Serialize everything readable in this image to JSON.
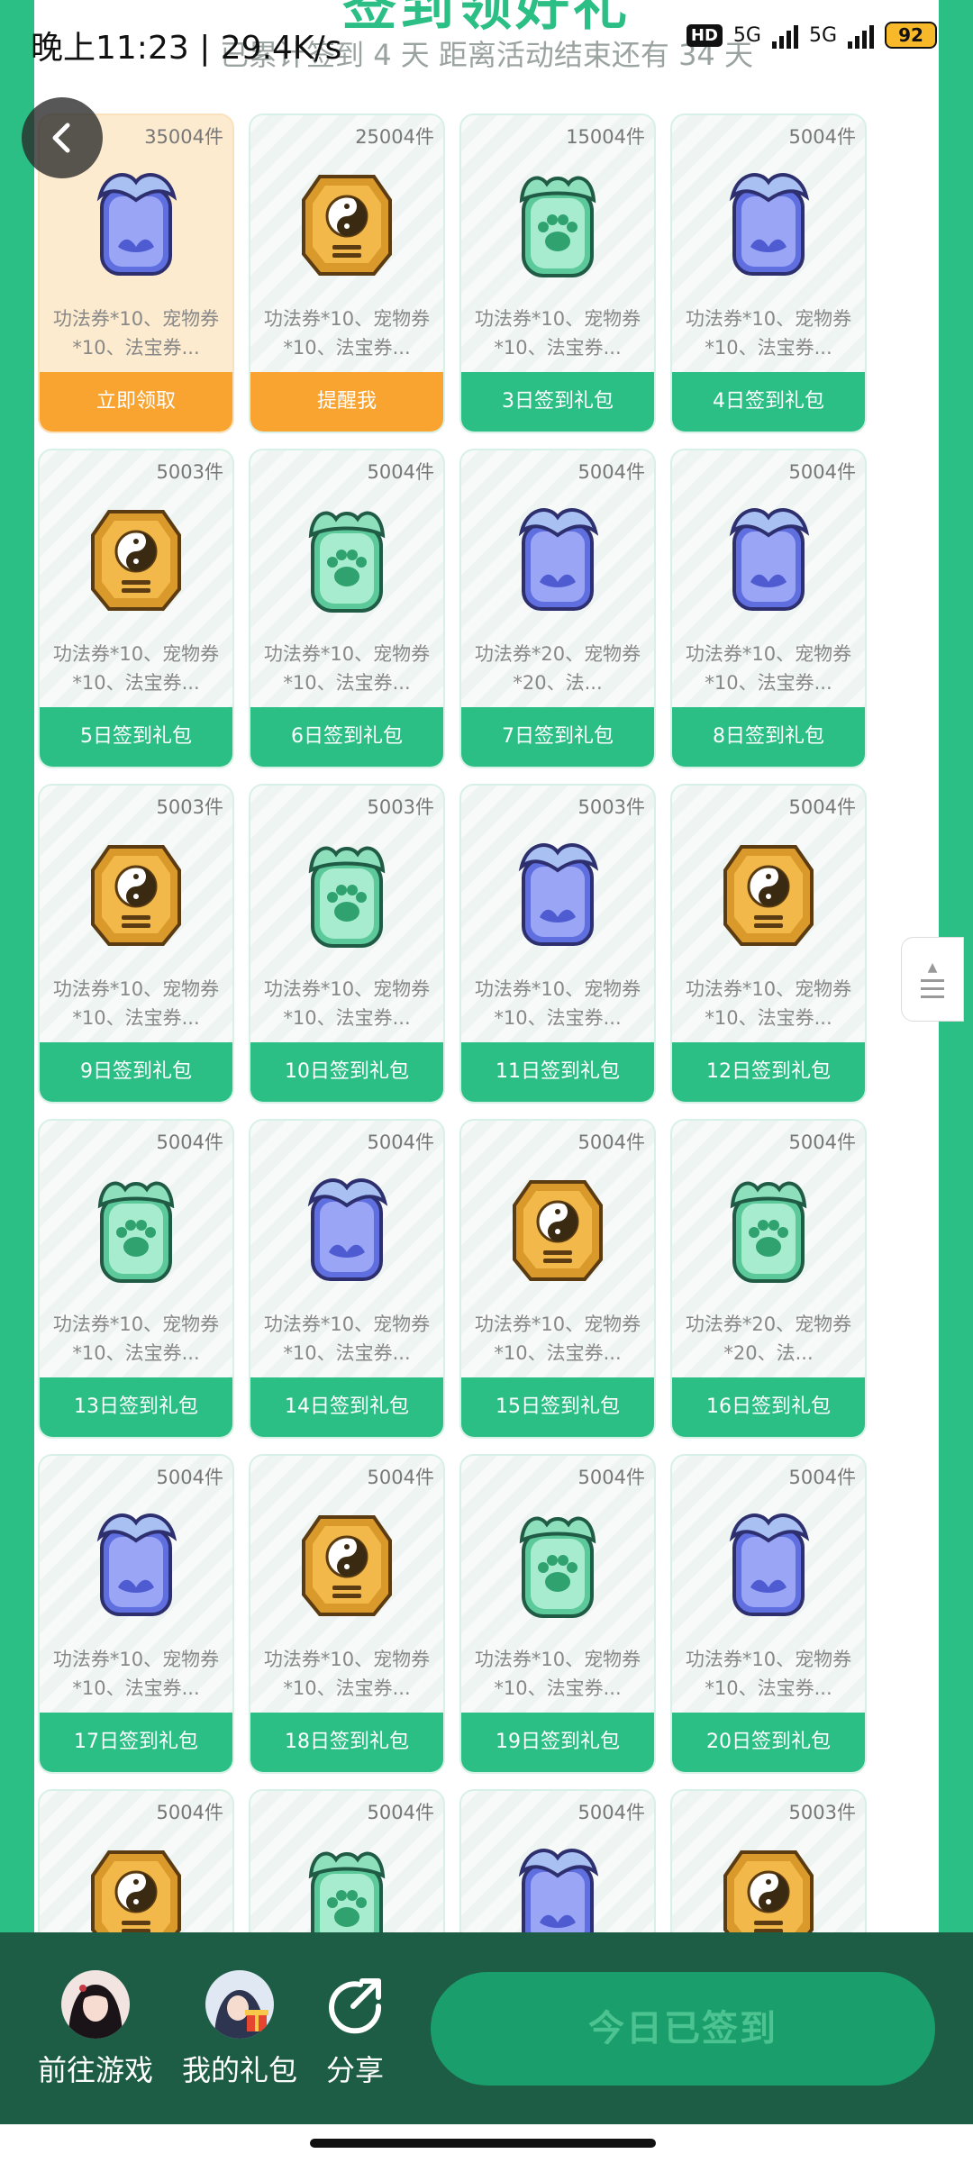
{
  "status_bar": {
    "time": "晚上11:23 | 29.4K/s",
    "network1": "5G",
    "network2": "5G",
    "hd": "HD",
    "battery": "92"
  },
  "banner": {
    "title": "签到领好礼",
    "subtitle": "已累计签到 4 天  距离活动结束还有 34 天"
  },
  "colors": {
    "accent": "#2bbf86",
    "orange": "#f9a431",
    "bottom_bar": "#1d5c45"
  },
  "rewards": [
    {
      "count": "35004件",
      "desc": "功法券*10、宠物券*10、法宝券...",
      "button": "立即领取",
      "icon": "blue-ghost-icon",
      "state": "claim"
    },
    {
      "count": "25004件",
      "desc": "功法券*10、宠物券*10、法宝券...",
      "button": "提醒我",
      "icon": "gold-taiji-icon",
      "state": "remind"
    },
    {
      "count": "15004件",
      "desc": "功法券*10、宠物券*10、法宝券...",
      "button": "3日签到礼包",
      "icon": "green-paw-icon",
      "state": "normal"
    },
    {
      "count": "5004件",
      "desc": "功法券*10、宠物券*10、法宝券...",
      "button": "4日签到礼包",
      "icon": "blue-ghost-icon",
      "state": "normal"
    },
    {
      "count": "5003件",
      "desc": "功法券*10、宠物券*10、法宝券...",
      "button": "5日签到礼包",
      "icon": "gold-taiji-icon",
      "state": "normal"
    },
    {
      "count": "5004件",
      "desc": "功法券*10、宠物券*10、法宝券...",
      "button": "6日签到礼包",
      "icon": "green-paw-icon",
      "state": "normal"
    },
    {
      "count": "5004件",
      "desc": "功法券*20、宠物券*20、法...",
      "button": "7日签到礼包",
      "icon": "blue-ghost-icon",
      "state": "normal"
    },
    {
      "count": "5004件",
      "desc": "功法券*10、宠物券*10、法宝券...",
      "button": "8日签到礼包",
      "icon": "blue-ghost-icon",
      "state": "normal"
    },
    {
      "count": "5003件",
      "desc": "功法券*10、宠物券*10、法宝券...",
      "button": "9日签到礼包",
      "icon": "gold-taiji-icon",
      "state": "normal"
    },
    {
      "count": "5003件",
      "desc": "功法券*10、宠物券*10、法宝券...",
      "button": "10日签到礼包",
      "icon": "green-paw-icon",
      "state": "normal"
    },
    {
      "count": "5003件",
      "desc": "功法券*10、宠物券*10、法宝券...",
      "button": "11日签到礼包",
      "icon": "blue-ghost-icon",
      "state": "normal"
    },
    {
      "count": "5004件",
      "desc": "功法券*10、宠物券*10、法宝券...",
      "button": "12日签到礼包",
      "icon": "gold-taiji-icon",
      "state": "normal"
    },
    {
      "count": "5004件",
      "desc": "功法券*10、宠物券*10、法宝券...",
      "button": "13日签到礼包",
      "icon": "green-paw-icon",
      "state": "normal"
    },
    {
      "count": "5004件",
      "desc": "功法券*10、宠物券*10、法宝券...",
      "button": "14日签到礼包",
      "icon": "blue-ghost-icon",
      "state": "normal"
    },
    {
      "count": "5004件",
      "desc": "功法券*10、宠物券*10、法宝券...",
      "button": "15日签到礼包",
      "icon": "gold-taiji-icon",
      "state": "normal"
    },
    {
      "count": "5004件",
      "desc": "功法券*20、宠物券*20、法...",
      "button": "16日签到礼包",
      "icon": "green-paw-icon",
      "state": "normal"
    },
    {
      "count": "5004件",
      "desc": "功法券*10、宠物券*10、法宝券...",
      "button": "17日签到礼包",
      "icon": "blue-ghost-icon",
      "state": "normal"
    },
    {
      "count": "5004件",
      "desc": "功法券*10、宠物券*10、法宝券...",
      "button": "18日签到礼包",
      "icon": "gold-taiji-icon",
      "state": "normal"
    },
    {
      "count": "5004件",
      "desc": "功法券*10、宠物券*10、法宝券...",
      "button": "19日签到礼包",
      "icon": "green-paw-icon",
      "state": "normal"
    },
    {
      "count": "5004件",
      "desc": "功法券*10、宠物券*10、法宝券...",
      "button": "20日签到礼包",
      "icon": "blue-ghost-icon",
      "state": "normal"
    },
    {
      "count": "5004件",
      "desc": "",
      "button": "",
      "icon": "gold-taiji-icon",
      "state": "normal"
    },
    {
      "count": "5004件",
      "desc": "",
      "button": "",
      "icon": "green-paw-icon",
      "state": "normal"
    },
    {
      "count": "5004件",
      "desc": "",
      "button": "",
      "icon": "blue-ghost-icon",
      "state": "normal"
    },
    {
      "count": "5003件",
      "desc": "",
      "button": "",
      "icon": "gold-taiji-icon",
      "state": "normal"
    }
  ],
  "bottom_bar": {
    "go_game": "前往游戏",
    "my_gifts": "我的礼包",
    "share": "分享",
    "sign_button": "今日已签到"
  }
}
